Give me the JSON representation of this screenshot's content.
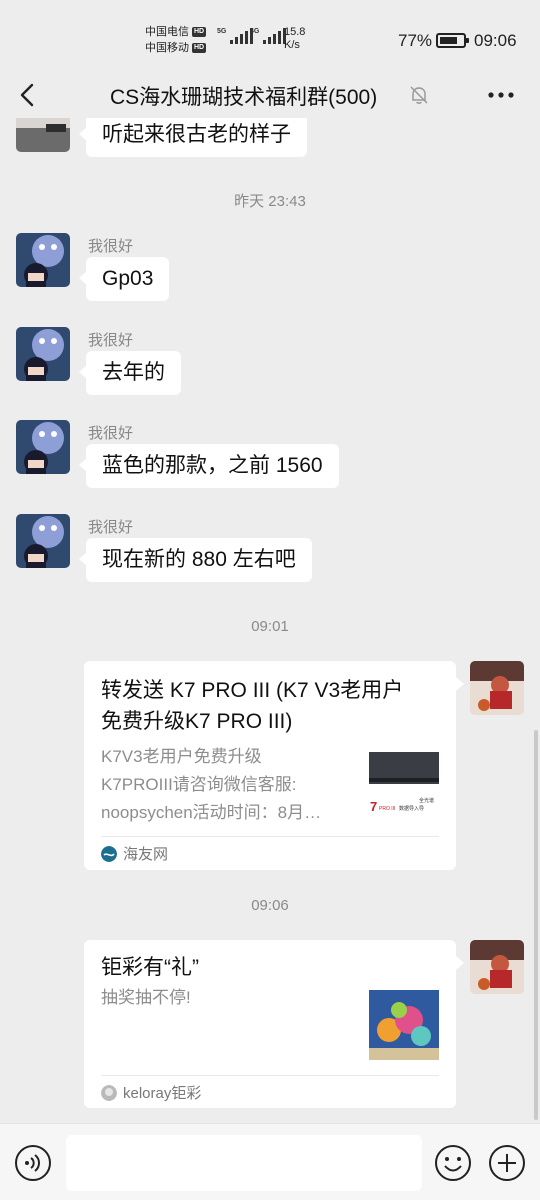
{
  "status": {
    "carrier1": "中国电信",
    "carrier2": "中国移动",
    "hd": "HD",
    "net1": "5G",
    "net2": "4G",
    "speed_value": "15.8",
    "speed_unit": "K/s",
    "battery_pct": "77%",
    "battery_level": 0.77,
    "time": "09:06"
  },
  "header": {
    "title": "CS海水珊瑚技术福利群(500)",
    "icons": [
      "back-icon",
      "mute-bell-icon",
      "more-icon"
    ]
  },
  "messages": {
    "m0": {
      "text": "听起来很古老的样子"
    },
    "ts1": "昨天 23:43",
    "m1": {
      "sender": "我很好",
      "text": "Gp03"
    },
    "m2": {
      "sender": "我很好",
      "text": "去年的"
    },
    "m3": {
      "sender": "我很好",
      "text": "蓝色的那款，之前 1560"
    },
    "m4": {
      "sender": "我很好",
      "text": "现在新的 880 左右吧"
    },
    "ts2": "09:01",
    "card1": {
      "title_line1": "转发送 K7 PRO III (K7 V3老用户",
      "title_line2": "免费升级K7 PRO III)",
      "desc_line1": "K7V3老用户免费升级",
      "desc_line2": "K7PROIII请咨询微信客服:",
      "desc_line3": "noopsychen活动时间：8月…",
      "thumb_text_brand": "7",
      "thumb_text_pro": "PRO III",
      "thumb_text_small1": "全光谱",
      "thumb_text_small2": "数据导入导",
      "source": "海友网"
    },
    "ts3": "09:06",
    "card2": {
      "title": "钜彩有“礼”",
      "desc": "抽奖抽不停!",
      "source": "keloray钜彩"
    }
  },
  "colors": {
    "background": "#ededed",
    "bubble": "#ffffff",
    "muted_text": "#8a8a8a"
  }
}
